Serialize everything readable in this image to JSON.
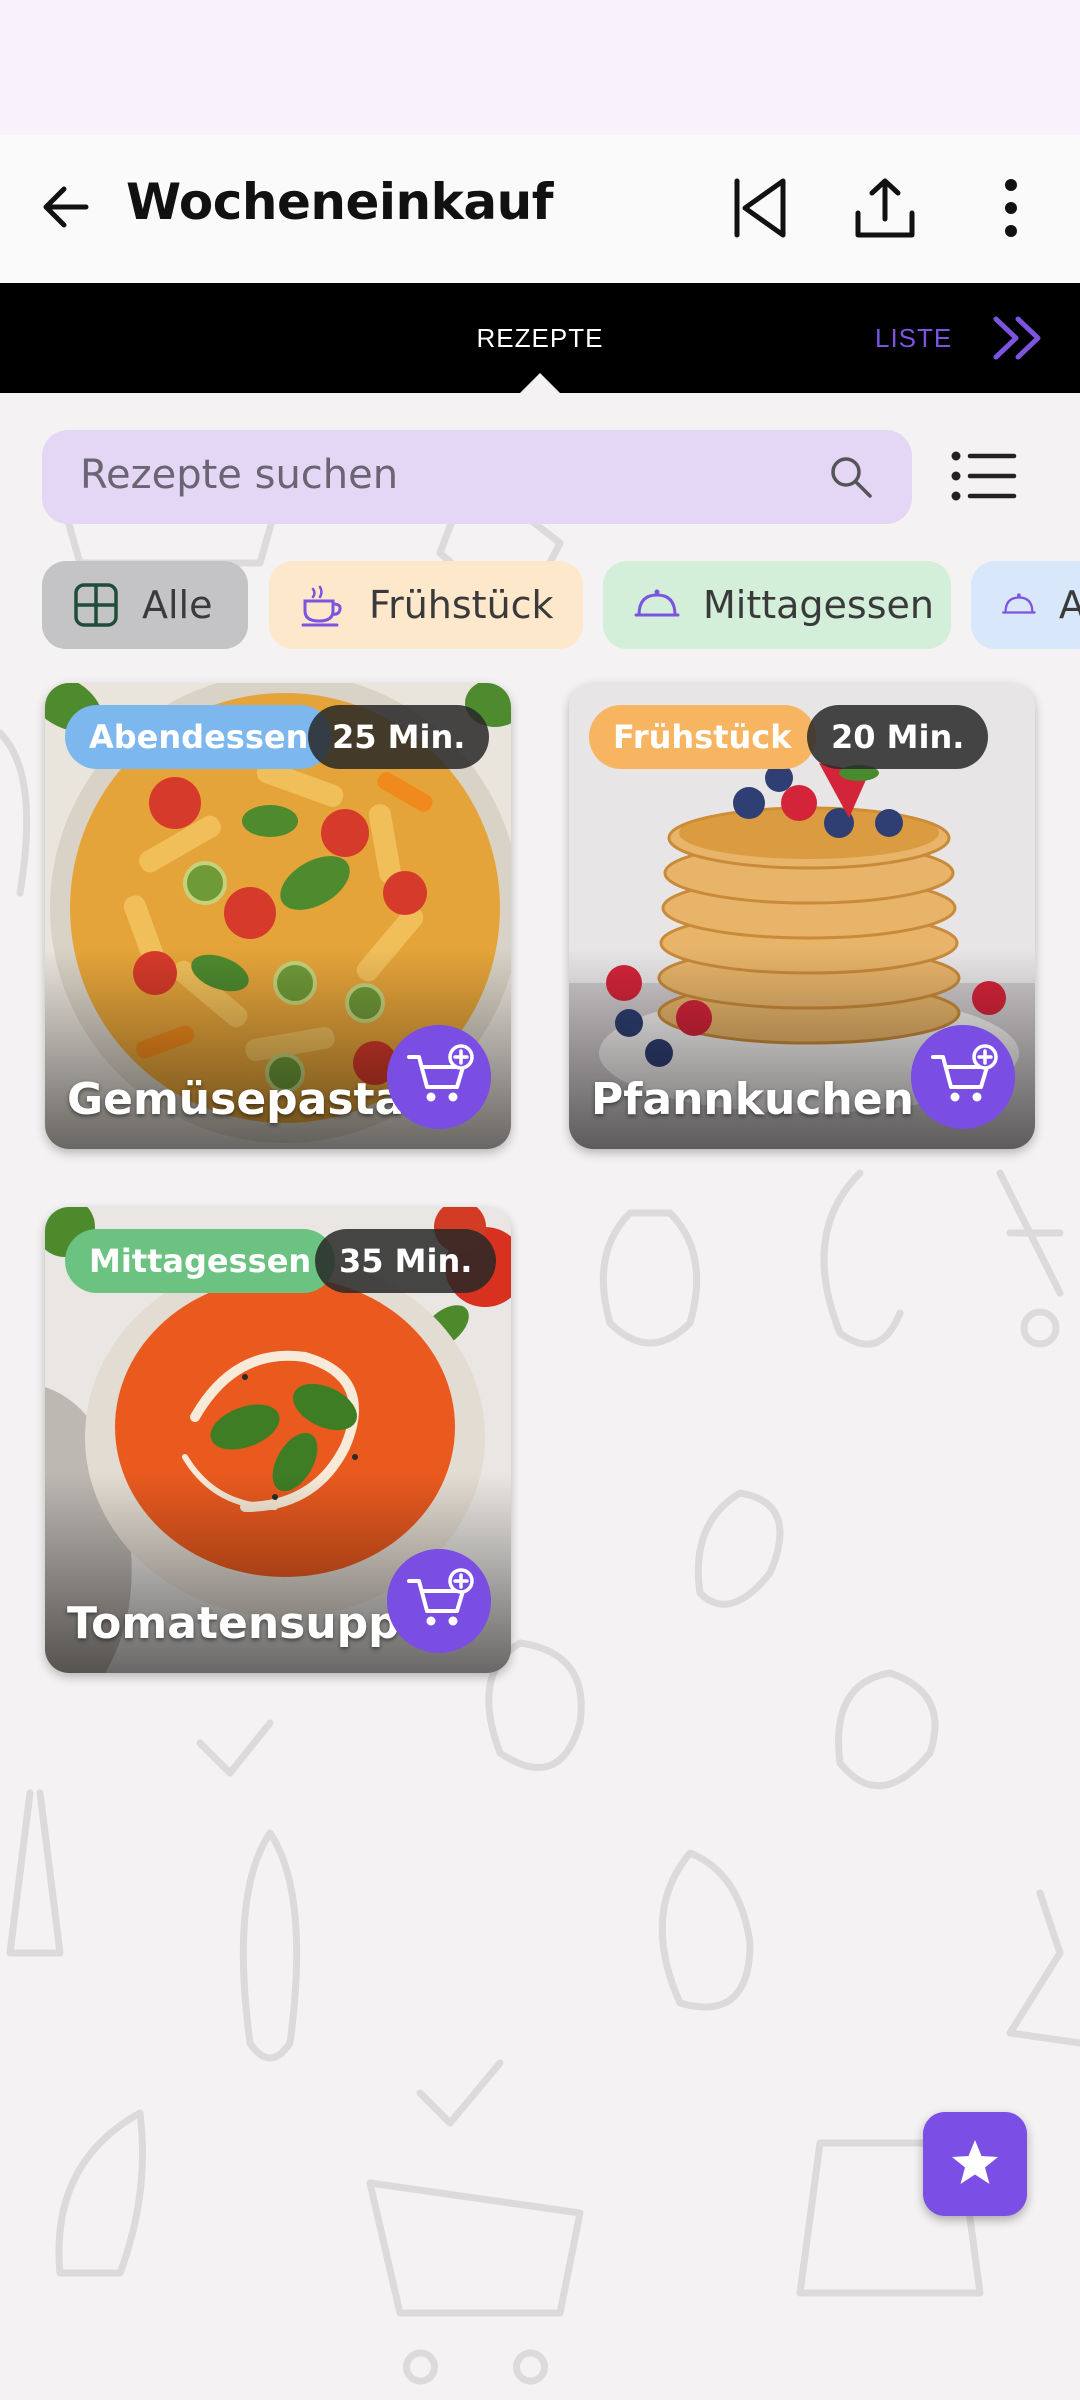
{
  "appbar": {
    "title": "Wocheneinkauf",
    "icons": [
      "back-arrow-icon",
      "skip-previous-icon",
      "share-icon",
      "more-vertical-icon"
    ]
  },
  "tabs": {
    "active": "REZEPTE",
    "next": "LISTE"
  },
  "search": {
    "placeholder": "Rezepte suchen"
  },
  "chips": [
    {
      "label": "Alle",
      "icon": "grid-icon",
      "color": "#c4c4c6"
    },
    {
      "label": "Frühstück",
      "icon": "coffee-cup-icon",
      "color": "#fde8cc"
    },
    {
      "label": "Mittagessen",
      "icon": "cloche-icon",
      "color": "#d3eed9"
    },
    {
      "label": "Abendessen",
      "icon": "cloche-icon",
      "color": "#d9e7fb"
    }
  ],
  "recipes": [
    {
      "name": "Gemüsepasta",
      "category": "Abendessen",
      "category_color": "#7cb7ee",
      "time": "25 Min."
    },
    {
      "name": "Pfannkuchen",
      "category": "Frühstück",
      "category_color": "#f7b562",
      "time": "20 Min."
    },
    {
      "name": "Tomatensuppe",
      "category": "Mittagessen",
      "category_color": "#6cc381",
      "time": "35 Min."
    }
  ],
  "colors": {
    "accent": "#7a4de3",
    "tabbar": "#000000"
  }
}
